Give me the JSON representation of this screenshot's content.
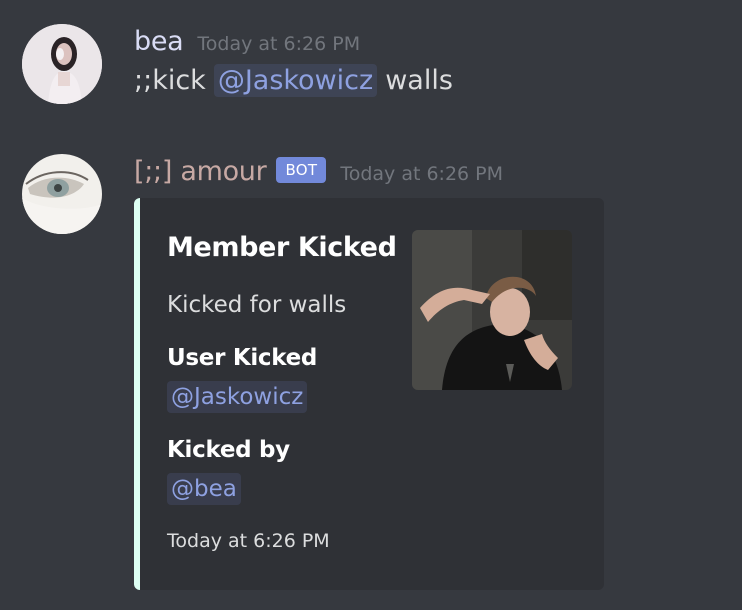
{
  "colors": {
    "background": "#36393f",
    "embed_background": "#2f3136",
    "embed_accent": "#ddfff3",
    "mention_text": "#8ea1e1",
    "timestamp": "#72767d",
    "bot_tag": "#7289da",
    "user1_name": "#d9dcf5",
    "user2_name": "#c7a9a4"
  },
  "messages": [
    {
      "avatar_icon": "girl-photo-avatar",
      "username": "bea",
      "timestamp": "Today at 6:26 PM",
      "content_prefix": ";;kick",
      "content_mention": "@Jaskowicz",
      "content_suffix": "walls"
    },
    {
      "avatar_icon": "eye-photo-avatar",
      "username": "[;;] amour",
      "bot_tag": "BOT",
      "timestamp": "Today at 6:26 PM",
      "embed": {
        "title": "Member Kicked",
        "description": "Kicked for walls",
        "thumbnail_icon": "user-photo-thumbnail",
        "fields": [
          {
            "name": "User Kicked",
            "value": "@Jaskowicz"
          },
          {
            "name": "Kicked by",
            "value": "@bea"
          }
        ],
        "footer": "Today at 6:26 PM"
      }
    }
  ]
}
